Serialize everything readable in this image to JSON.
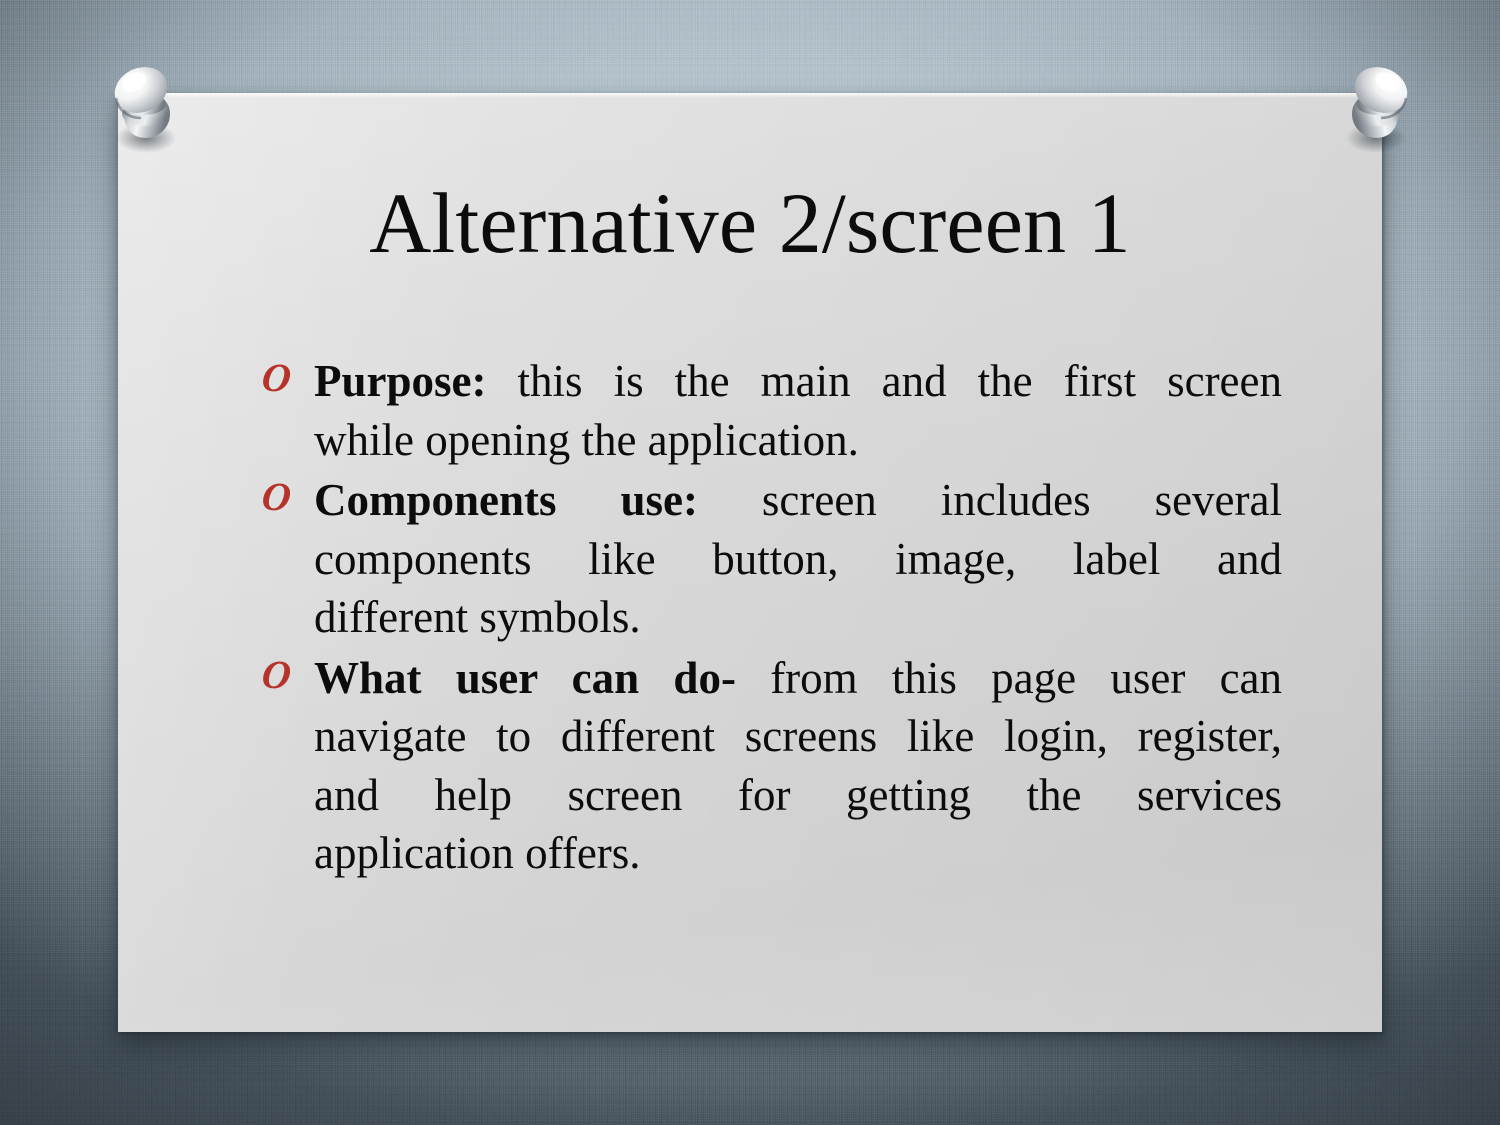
{
  "slide": {
    "title": "Alternative 2/screen 1",
    "bullet_marker": "O",
    "bullet_marker_color": "#b5332a",
    "panel_color": "#d6d6d6",
    "background_color": "#b2c1cb",
    "text_color": "#0c0c0c",
    "bullets": [
      {
        "lead": "Purpose:",
        "body": "this is the main and the first screen while opening the application.",
        "lines": [
          {
            "lead": "Purpose:",
            "rest": "this is the main and the first screen",
            "last": false
          },
          {
            "lead": "",
            "rest": "while opening the application.",
            "last": true
          }
        ]
      },
      {
        "lead": "Components use:",
        "body": "screen includes several components like button, image, label and different symbols.",
        "lines": [
          {
            "lead": "Components use:",
            "rest": "screen includes several",
            "last": false
          },
          {
            "lead": "",
            "rest": "components like button, image, label and",
            "last": false
          },
          {
            "lead": "",
            "rest": "different symbols.",
            "last": true
          }
        ]
      },
      {
        "lead": "What user can do-",
        "body": "from this page user can navigate to different screens like login, register, and help screen for getting the services application offers.",
        "lines": [
          {
            "lead": "What user can do-",
            "rest": "from this page user can",
            "last": false
          },
          {
            "lead": "",
            "rest": "navigate to different screens like login, register,",
            "last": false
          },
          {
            "lead": "",
            "rest": "and help screen for getting the services",
            "last": false
          },
          {
            "lead": "",
            "rest": "application offers.",
            "last": true
          }
        ]
      }
    ],
    "pins": [
      {
        "name": "pushpin-left",
        "position": "top-left"
      },
      {
        "name": "pushpin-right",
        "position": "top-right"
      }
    ]
  }
}
